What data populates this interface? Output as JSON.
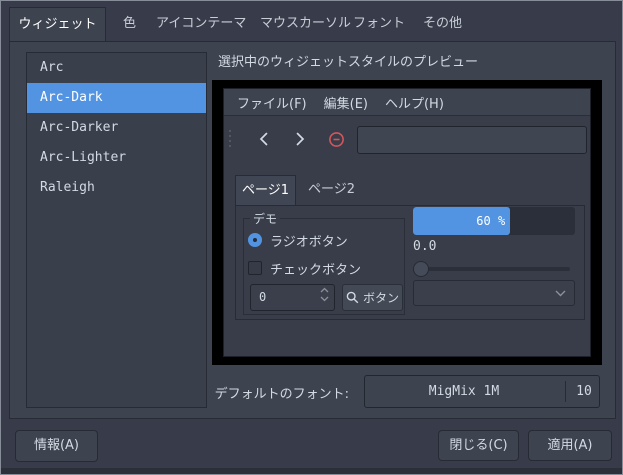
{
  "colors": {
    "accent": "#5294e2",
    "selection": "#5294e2",
    "stop_red": "#d4555c",
    "window_bg": "#383c4a"
  },
  "tabs": {
    "items": [
      "ウィジェット",
      "色",
      "アイコンテーマ",
      "マウスカーソル",
      "フォント",
      "その他"
    ],
    "active": "ウィジェット"
  },
  "widget_list": {
    "items": [
      "Arc",
      "Arc-Dark",
      "Arc-Darker",
      "Arc-Lighter",
      "Raleigh"
    ],
    "selected": "Arc-Dark",
    "selected_index": 1
  },
  "preview": {
    "title": "選択中のウィジェットスタイルのプレビュー",
    "menubar": {
      "file": "ファイル(F)",
      "edit": "編集(E)",
      "help": "ヘルプ(H)"
    },
    "toolbar": {
      "entry_value": ""
    },
    "tabs": {
      "page1": "ページ1",
      "page2": "ページ2",
      "active": "ページ1"
    },
    "demo": {
      "legend": "デモ",
      "radio_label": "ラジオボタン",
      "radio_checked": true,
      "checkbox_label": "チェックボタン",
      "checkbox_checked": false,
      "spin_value": "0",
      "button_label": "ボタン"
    },
    "progress": {
      "percent": 60,
      "label": "60 %"
    },
    "scale_value": "0.0",
    "combo_value": ""
  },
  "font_row": {
    "label": "デフォルトのフォント:",
    "name": "MigMix 1M",
    "size": "10"
  },
  "actions": {
    "info": "情報(A)",
    "close": "閉じる(C)",
    "apply": "適用(A)"
  }
}
